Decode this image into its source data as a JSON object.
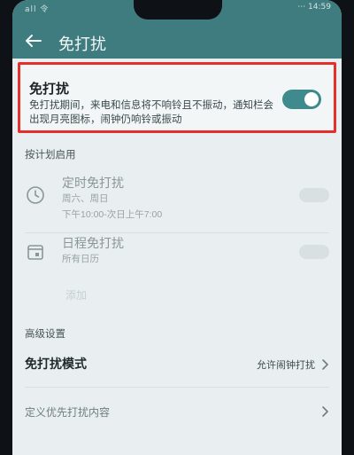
{
  "status_bar": {
    "left": "all 令",
    "right": "⋯ 14:59"
  },
  "header": {
    "title": "免打扰",
    "back_icon": "arrow-left-icon"
  },
  "dnd": {
    "title": "免打扰",
    "description": "免打扰期间，来电和信息将不响铃且不振动，通知栏会出现月亮图标，闹钟仍响铃或振动",
    "toggle_on": true,
    "accent": "#3e8a8c",
    "highlight": "#e3302c"
  },
  "schedule_section": {
    "label": "按计划启用",
    "items": [
      {
        "icon": "clock-icon",
        "title": "定时免打扰",
        "sub1": "周六、周日",
        "sub2": "下午10:00-次日上午7:00"
      },
      {
        "icon": "calendar-icon",
        "title": "日程免打扰",
        "sub1": "所有日历"
      }
    ],
    "add_label": "添加"
  },
  "advanced_section": {
    "label": "高级设置",
    "mode_title": "免打扰模式",
    "mode_value": "允许闹钟打扰",
    "priority_title": "定义优先打扰内容"
  }
}
